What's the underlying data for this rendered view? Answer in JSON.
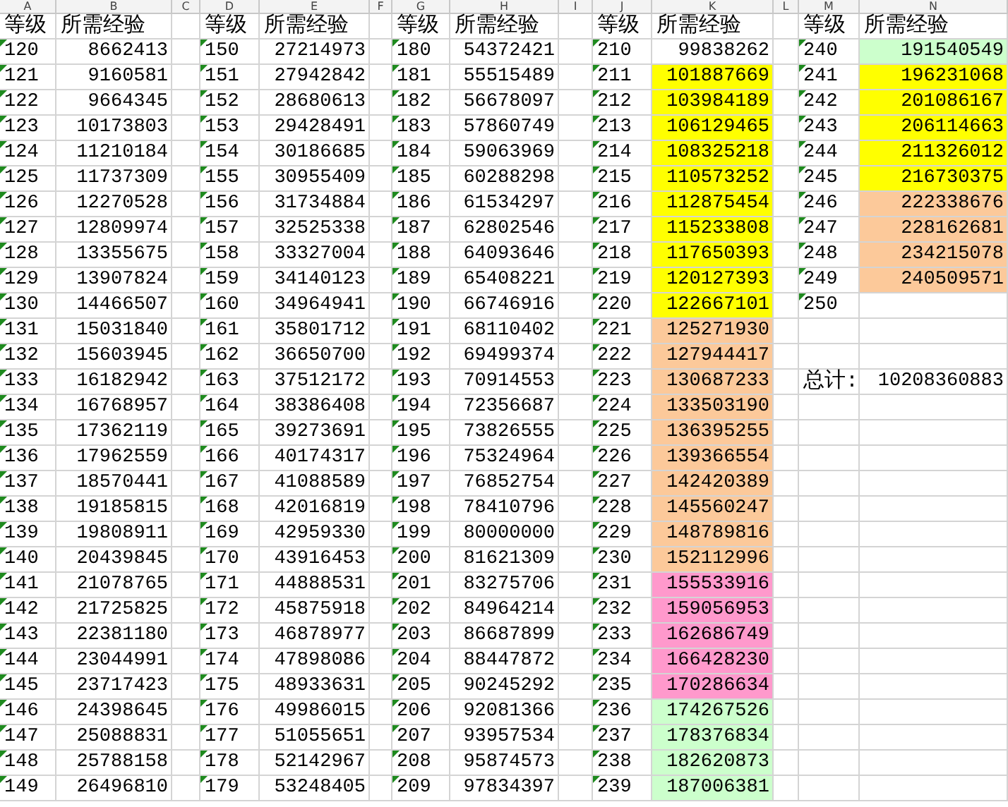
{
  "columns": [
    "A",
    "B",
    "C",
    "D",
    "E",
    "F",
    "G",
    "H",
    "I",
    "J",
    "K",
    "L",
    "M",
    "N"
  ],
  "tables": [
    {
      "headers": [
        "等级",
        "所需经验"
      ],
      "rows": [
        {
          "level": "120",
          "exp": "8662413"
        },
        {
          "level": "121",
          "exp": "9160581"
        },
        {
          "level": "122",
          "exp": "9664345"
        },
        {
          "level": "123",
          "exp": "10173803"
        },
        {
          "level": "124",
          "exp": "11210184"
        },
        {
          "level": "125",
          "exp": "11737309"
        },
        {
          "level": "126",
          "exp": "12270528"
        },
        {
          "level": "127",
          "exp": "12809974"
        },
        {
          "level": "128",
          "exp": "13355675"
        },
        {
          "level": "129",
          "exp": "13907824"
        },
        {
          "level": "130",
          "exp": "14466507"
        },
        {
          "level": "131",
          "exp": "15031840"
        },
        {
          "level": "132",
          "exp": "15603945"
        },
        {
          "level": "133",
          "exp": "16182942"
        },
        {
          "level": "134",
          "exp": "16768957"
        },
        {
          "level": "135",
          "exp": "17362119"
        },
        {
          "level": "136",
          "exp": "17962559"
        },
        {
          "level": "137",
          "exp": "18570441"
        },
        {
          "level": "138",
          "exp": "19185815"
        },
        {
          "level": "139",
          "exp": "19808911"
        },
        {
          "level": "140",
          "exp": "20439845"
        },
        {
          "level": "141",
          "exp": "21078765"
        },
        {
          "level": "142",
          "exp": "21725825"
        },
        {
          "level": "143",
          "exp": "22381180"
        },
        {
          "level": "144",
          "exp": "23044991"
        },
        {
          "level": "145",
          "exp": "23717423"
        },
        {
          "level": "146",
          "exp": "24398645"
        },
        {
          "level": "147",
          "exp": "25088831"
        },
        {
          "level": "148",
          "exp": "25788158"
        },
        {
          "level": "149",
          "exp": "26496810"
        }
      ]
    },
    {
      "headers": [
        "等级",
        "所需经验"
      ],
      "rows": [
        {
          "level": "150",
          "exp": "27214973"
        },
        {
          "level": "151",
          "exp": "27942842"
        },
        {
          "level": "152",
          "exp": "28680613"
        },
        {
          "level": "153",
          "exp": "29428491"
        },
        {
          "level": "154",
          "exp": "30186685"
        },
        {
          "level": "155",
          "exp": "30955409"
        },
        {
          "level": "156",
          "exp": "31734884"
        },
        {
          "level": "157",
          "exp": "32525338"
        },
        {
          "level": "158",
          "exp": "33327004"
        },
        {
          "level": "159",
          "exp": "34140123"
        },
        {
          "level": "160",
          "exp": "34964941"
        },
        {
          "level": "161",
          "exp": "35801712"
        },
        {
          "level": "162",
          "exp": "36650700"
        },
        {
          "level": "163",
          "exp": "37512172"
        },
        {
          "level": "164",
          "exp": "38386408"
        },
        {
          "level": "165",
          "exp": "39273691"
        },
        {
          "level": "166",
          "exp": "40174317"
        },
        {
          "level": "167",
          "exp": "41088589"
        },
        {
          "level": "168",
          "exp": "42016819"
        },
        {
          "level": "169",
          "exp": "42959330"
        },
        {
          "level": "170",
          "exp": "43916453"
        },
        {
          "level": "171",
          "exp": "44888531"
        },
        {
          "level": "172",
          "exp": "45875918"
        },
        {
          "level": "173",
          "exp": "46878977"
        },
        {
          "level": "174",
          "exp": "47898086"
        },
        {
          "level": "175",
          "exp": "48933631"
        },
        {
          "level": "176",
          "exp": "49986015"
        },
        {
          "level": "177",
          "exp": "51055651"
        },
        {
          "level": "178",
          "exp": "52142967"
        },
        {
          "level": "179",
          "exp": "53248405"
        }
      ]
    },
    {
      "headers": [
        "等级",
        "所需经验"
      ],
      "rows": [
        {
          "level": "180",
          "exp": "54372421"
        },
        {
          "level": "181",
          "exp": "55515489"
        },
        {
          "level": "182",
          "exp": "56678097"
        },
        {
          "level": "183",
          "exp": "57860749"
        },
        {
          "level": "184",
          "exp": "59063969"
        },
        {
          "level": "185",
          "exp": "60288298"
        },
        {
          "level": "186",
          "exp": "61534297"
        },
        {
          "level": "187",
          "exp": "62802546"
        },
        {
          "level": "188",
          "exp": "64093646"
        },
        {
          "level": "189",
          "exp": "65408221"
        },
        {
          "level": "190",
          "exp": "66746916"
        },
        {
          "level": "191",
          "exp": "68110402"
        },
        {
          "level": "192",
          "exp": "69499374"
        },
        {
          "level": "193",
          "exp": "70914553"
        },
        {
          "level": "194",
          "exp": "72356687"
        },
        {
          "level": "195",
          "exp": "73826555"
        },
        {
          "level": "196",
          "exp": "75324964"
        },
        {
          "level": "197",
          "exp": "76852754"
        },
        {
          "level": "198",
          "exp": "78410796"
        },
        {
          "level": "199",
          "exp": "80000000"
        },
        {
          "level": "200",
          "exp": "81621309"
        },
        {
          "level": "201",
          "exp": "83275706"
        },
        {
          "level": "202",
          "exp": "84964214"
        },
        {
          "level": "203",
          "exp": "86687899"
        },
        {
          "level": "204",
          "exp": "88447872"
        },
        {
          "level": "205",
          "exp": "90245292"
        },
        {
          "level": "206",
          "exp": "92081366"
        },
        {
          "level": "207",
          "exp": "93957534"
        },
        {
          "level": "208",
          "exp": "95874573"
        },
        {
          "level": "209",
          "exp": "97834397"
        }
      ]
    },
    {
      "headers": [
        "等级",
        "所需经验"
      ],
      "rows": [
        {
          "level": "210",
          "exp": "99838262"
        },
        {
          "level": "211",
          "exp": "101887669",
          "color": "#ffff00"
        },
        {
          "level": "212",
          "exp": "103984189",
          "color": "#ffff00"
        },
        {
          "level": "213",
          "exp": "106129465",
          "color": "#ffff00"
        },
        {
          "level": "214",
          "exp": "108325218",
          "color": "#ffff00"
        },
        {
          "level": "215",
          "exp": "110573252",
          "color": "#ffff00"
        },
        {
          "level": "216",
          "exp": "112875454",
          "color": "#ffff00"
        },
        {
          "level": "217",
          "exp": "115233808",
          "color": "#ffff00"
        },
        {
          "level": "218",
          "exp": "117650393",
          "color": "#ffff00"
        },
        {
          "level": "219",
          "exp": "120127393",
          "color": "#ffff00"
        },
        {
          "level": "220",
          "exp": "122667101",
          "color": "#ffff00"
        },
        {
          "level": "221",
          "exp": "125271930",
          "color": "#fcc99a"
        },
        {
          "level": "222",
          "exp": "127944417",
          "color": "#fcc99a"
        },
        {
          "level": "223",
          "exp": "130687233",
          "color": "#fcc99a"
        },
        {
          "level": "224",
          "exp": "133503190",
          "color": "#fcc99a"
        },
        {
          "level": "225",
          "exp": "136395255",
          "color": "#fcc99a"
        },
        {
          "level": "226",
          "exp": "139366554",
          "color": "#fcc99a"
        },
        {
          "level": "227",
          "exp": "142420389",
          "color": "#fcc99a"
        },
        {
          "level": "228",
          "exp": "145560247",
          "color": "#fcc99a"
        },
        {
          "level": "229",
          "exp": "148789816",
          "color": "#fcc99a"
        },
        {
          "level": "230",
          "exp": "152112996",
          "color": "#fcc99a"
        },
        {
          "level": "231",
          "exp": "155533916",
          "color": "#ff99cc"
        },
        {
          "level": "232",
          "exp": "159056953",
          "color": "#ff99cc"
        },
        {
          "level": "233",
          "exp": "162686749",
          "color": "#ff99cc"
        },
        {
          "level": "234",
          "exp": "166428230",
          "color": "#ff99cc"
        },
        {
          "level": "235",
          "exp": "170286634",
          "color": "#ff99cc"
        },
        {
          "level": "236",
          "exp": "174267526",
          "color": "#ccffcc"
        },
        {
          "level": "237",
          "exp": "178376834",
          "color": "#ccffcc"
        },
        {
          "level": "238",
          "exp": "182620873",
          "color": "#ccffcc"
        },
        {
          "level": "239",
          "exp": "187006381",
          "color": "#ccffcc"
        }
      ]
    },
    {
      "headers": [
        "等级",
        "所需经验"
      ],
      "rows": [
        {
          "level": "240",
          "exp": "191540549",
          "color": "#ccffcc"
        },
        {
          "level": "241",
          "exp": "196231068",
          "color": "#ffff00"
        },
        {
          "level": "242",
          "exp": "201086167",
          "color": "#ffff00"
        },
        {
          "level": "243",
          "exp": "206114663",
          "color": "#ffff00"
        },
        {
          "level": "244",
          "exp": "211326012",
          "color": "#ffff00"
        },
        {
          "level": "245",
          "exp": "216730375",
          "color": "#ffff00"
        },
        {
          "level": "246",
          "exp": "222338676",
          "color": "#fcc99a"
        },
        {
          "level": "247",
          "exp": "228162681",
          "color": "#fcc99a"
        },
        {
          "level": "248",
          "exp": "234215078",
          "color": "#fcc99a"
        },
        {
          "level": "249",
          "exp": "240509571",
          "color": "#fcc99a"
        },
        {
          "level": "250"
        }
      ]
    }
  ],
  "total": {
    "label": "总计:",
    "value": "10208360883"
  }
}
